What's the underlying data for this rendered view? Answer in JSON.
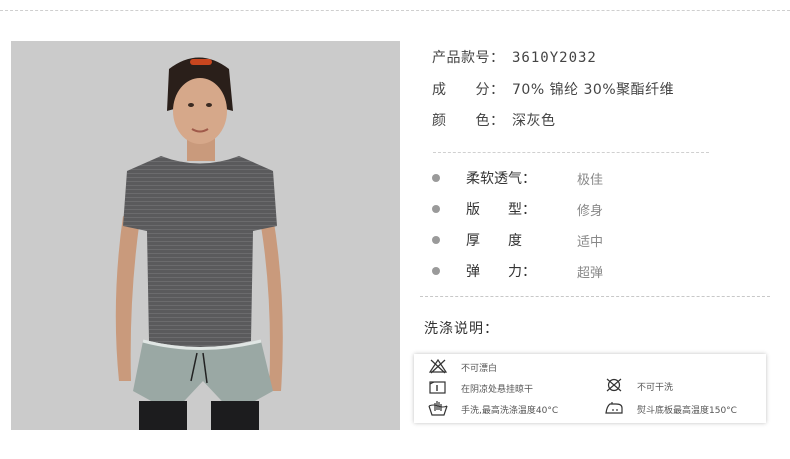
{
  "product": {
    "code_label": "产品款号：",
    "code_value": "3610Y2032",
    "composition_label": "成　　分：",
    "composition_value": "70% 锦纶 30%聚酯纤维",
    "color_label": "颜　　色：",
    "color_value": "深灰色"
  },
  "features": [
    {
      "label": "柔软透气：",
      "value": "极佳"
    },
    {
      "label": "版　　型：",
      "value": "修身"
    },
    {
      "label": "厚　　度",
      "value": "适中"
    },
    {
      "label": "弹　　力：",
      "value": "超弹"
    }
  ],
  "wash": {
    "title": "洗涤说明：",
    "items": [
      {
        "icon": "no-bleach-icon",
        "text": "不可漂白"
      },
      {
        "icon": "shade-dry-icon",
        "text": "在阴凉处悬挂晾干"
      },
      {
        "icon": "no-dry-clean-icon",
        "text": "不可干洗"
      },
      {
        "icon": "hand-wash-icon",
        "text": "手洗,最高洗涤温度40°C"
      },
      {
        "icon": "iron-icon",
        "text": "熨斗底板最高温度150°C"
      }
    ]
  },
  "colors": {
    "photo_bg": "#c9c9c9",
    "shirt": "#5a5a5c",
    "text": "#444444",
    "bullet": "#9a9a9a"
  }
}
